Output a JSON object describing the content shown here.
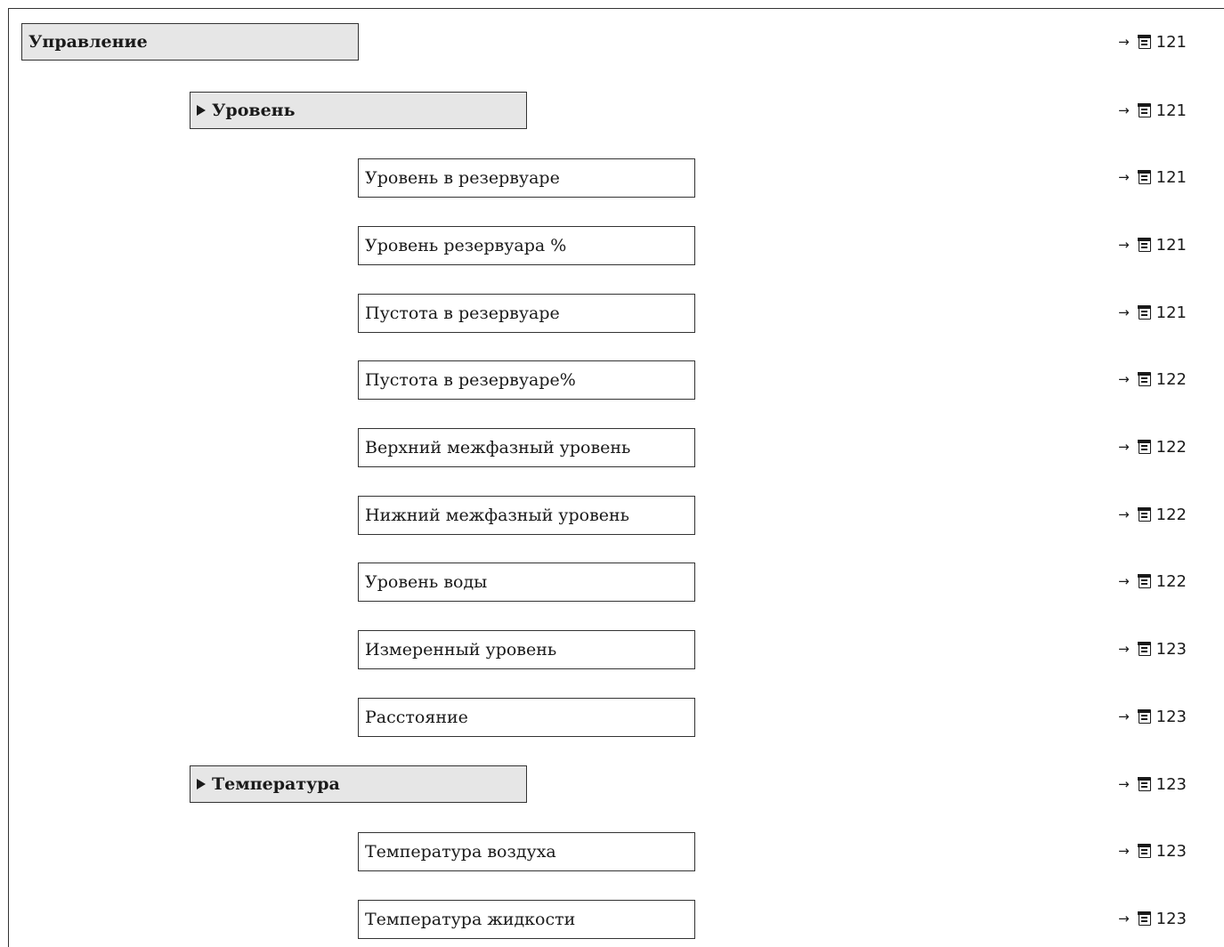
{
  "menu": {
    "title": "Управление",
    "title_ref": "121",
    "submenus": [
      {
        "label": "Уровень",
        "ref": "121",
        "parameters": [
          {
            "label": "Уровень в резервуаре",
            "ref": "121"
          },
          {
            "label": "Уровень резервуара %",
            "ref": "121"
          },
          {
            "label": "Пустота в резервуаре",
            "ref": "121"
          },
          {
            "label": "Пустота в резервуаре%",
            "ref": "122"
          },
          {
            "label": "Верхний межфазный уровень",
            "ref": "122"
          },
          {
            "label": "Нижний межфазный уровень",
            "ref": "122"
          },
          {
            "label": "Уровень воды",
            "ref": "122"
          },
          {
            "label": "Измеренный уровень",
            "ref": "123"
          },
          {
            "label": "Расстояние",
            "ref": "123"
          }
        ]
      },
      {
        "label": "Температура",
        "ref": "123",
        "parameters": [
          {
            "label": "Температура воздуха",
            "ref": "123"
          },
          {
            "label": "Температура жидкости",
            "ref": "123"
          }
        ]
      }
    ]
  },
  "icons": {
    "arrow": "→",
    "page": "page-reference-icon",
    "submenu_marker": "triangle-right-icon"
  }
}
